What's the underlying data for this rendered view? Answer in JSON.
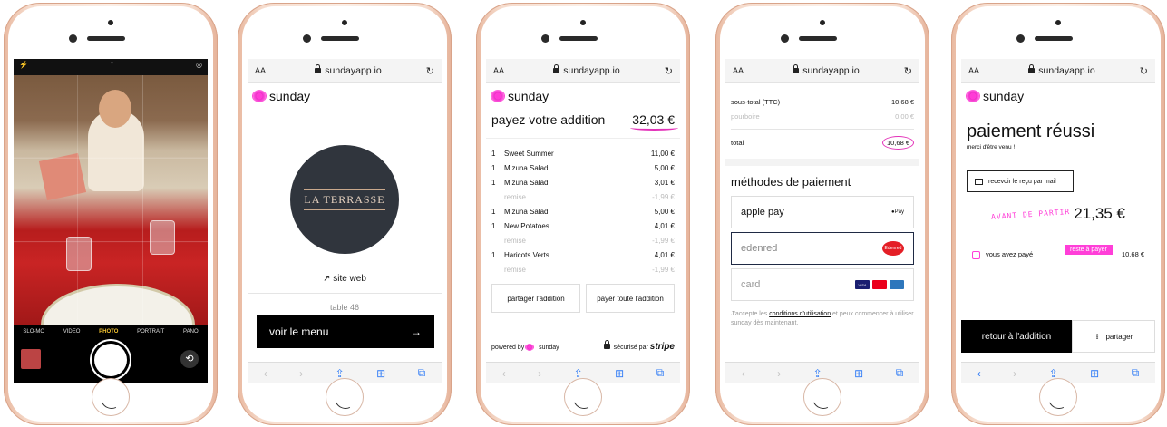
{
  "camera": {
    "modes": [
      "SLO-MO",
      "VIDEO",
      "PHOTO",
      "PORTRAIT",
      "PANO"
    ],
    "active_mode": "PHOTO"
  },
  "browser": {
    "aa": "AA",
    "url": "sundayapp.io",
    "reload": "↻",
    "toolbar": [
      "‹",
      "›",
      "⇪",
      "⊞",
      "⧉"
    ]
  },
  "brand": "sunday",
  "restaurant": {
    "logo": "LA TERRASSE",
    "site_link": "site web",
    "table": "table 46",
    "menu_button": "voir le menu",
    "arrow": "→"
  },
  "bill": {
    "title": "payez votre addition",
    "total": "32,03 €",
    "items": [
      {
        "qty": "1",
        "name": "Sweet Summer",
        "price": "11,00 €"
      },
      {
        "qty": "1",
        "name": "Mizuna Salad",
        "price": "5,00 €"
      },
      {
        "qty": "1",
        "name": "Mizuna Salad",
        "price": "3,01 €"
      },
      {
        "qty": "",
        "name": "remise",
        "price": "-1,99 €",
        "muted": true
      },
      {
        "qty": "1",
        "name": "Mizuna Salad",
        "price": "5,00 €"
      },
      {
        "qty": "1",
        "name": "New Potatoes",
        "price": "4,01 €"
      },
      {
        "qty": "",
        "name": "remise",
        "price": "-1,99 €",
        "muted": true
      },
      {
        "qty": "1",
        "name": "Haricots Verts",
        "price": "4,01 €"
      },
      {
        "qty": "",
        "name": "remise",
        "price": "-1,99 €",
        "muted": true
      }
    ],
    "split_button": "partager l'addition",
    "pay_all_button": "payer toute l'addition",
    "powered_by": "powered by",
    "secured_by": "sécurisé par",
    "stripe": "stripe"
  },
  "payment": {
    "subtotal_label": "sous-total (TTC)",
    "subtotal": "10,68 €",
    "tip_label": "pourboire",
    "tip": "0,00 €",
    "total_label": "total",
    "total": "10,68 €",
    "methods_title": "méthodes de paiement",
    "methods": [
      {
        "label": "apple pay",
        "logo": "●Pay"
      },
      {
        "label": "edenred",
        "logo": "Edenred"
      },
      {
        "label": "card",
        "logo": "VISA"
      }
    ],
    "terms_prefix": "J'accepte les ",
    "terms_link": "conditions d'utilisation",
    "terms_suffix": " et peux commencer à utiliser sunday dès maintenant."
  },
  "success": {
    "title": "paiement réussi",
    "subtitle": "merci d'être venu !",
    "mail_button": "recevoir le reçu par mail",
    "before_leave": "AVANT DE PARTIR",
    "remaining": "21,35 €",
    "remaining_label": "reste à payer",
    "paid_label": "vous avez payé",
    "paid": "10,68 €",
    "back_button": "retour à l'addition",
    "share_button": "partager"
  },
  "colors": {
    "accent": "#ff3fd8",
    "dark": "#000000",
    "link": "#2f7bf6"
  }
}
